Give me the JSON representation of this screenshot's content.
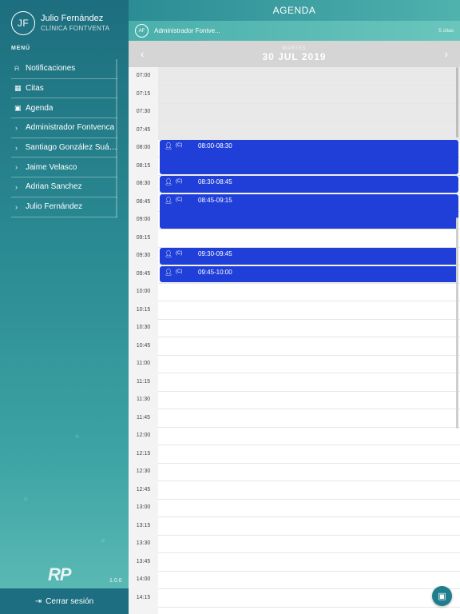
{
  "user": {
    "initials": "JF",
    "name": "Julio Fernández",
    "clinic": "CLÍNICA FONTVENTA"
  },
  "menu": {
    "title": "MENÚ",
    "items": [
      {
        "label": "Notificaciones",
        "icon": "bell-icon"
      },
      {
        "label": "Citas",
        "icon": "calendar-icon"
      },
      {
        "label": "Agenda",
        "icon": "agenda-icon"
      },
      {
        "label": "Administrador Fontvenca",
        "icon": "chevron-right-icon",
        "sub": true
      },
      {
        "label": "Santiago González Suárez",
        "icon": "chevron-right-icon",
        "sub": true
      },
      {
        "label": "Jaime Velasco",
        "icon": "chevron-right-icon",
        "sub": true
      },
      {
        "label": "Adrian Sanchez",
        "icon": "chevron-right-icon",
        "sub": true
      },
      {
        "label": "Julio Fernández",
        "icon": "chevron-right-icon",
        "sub": true
      }
    ]
  },
  "logo_text": "RP",
  "version": "1.0.6",
  "logout_label": "Cerrar sesión",
  "header": {
    "title": "AGENDA"
  },
  "doctor_bar": {
    "initials": "AF",
    "name": "Administrador Fontve...",
    "count": "5 citas"
  },
  "date": {
    "day_of_week": "MARTES",
    "date": "30 JUL 2019"
  },
  "time_slots": [
    "07:00",
    "07:15",
    "07:30",
    "07:45",
    "08:00",
    "08:15",
    "08:30",
    "08:45",
    "09:00",
    "09:15",
    "09:30",
    "09:45",
    "10:00",
    "10:15",
    "10:30",
    "10:45",
    "11:00",
    "11:15",
    "11:30",
    "11:45",
    "12:00",
    "12:15",
    "12:30",
    "12:45",
    "13:00",
    "13:15",
    "13:30",
    "13:45",
    "14:00",
    "14:15"
  ],
  "appointments": [
    {
      "tag": "(C)",
      "time": "08:00-08:30",
      "start": "08:00",
      "end": "08:30"
    },
    {
      "tag": "(C)",
      "time": "08:30-08:45",
      "start": "08:30",
      "end": "08:45"
    },
    {
      "tag": "(C)",
      "time": "08:45-09:15",
      "start": "08:45",
      "end": "09:15"
    },
    {
      "tag": "(C)",
      "time": "09:30-09:45",
      "start": "09:30",
      "end": "09:45"
    },
    {
      "tag": "(C)",
      "time": "09:45-10:00",
      "start": "09:45",
      "end": "10:00"
    }
  ],
  "colors": {
    "appointment": "#1f3fd8",
    "accent": "#2b8c95"
  }
}
